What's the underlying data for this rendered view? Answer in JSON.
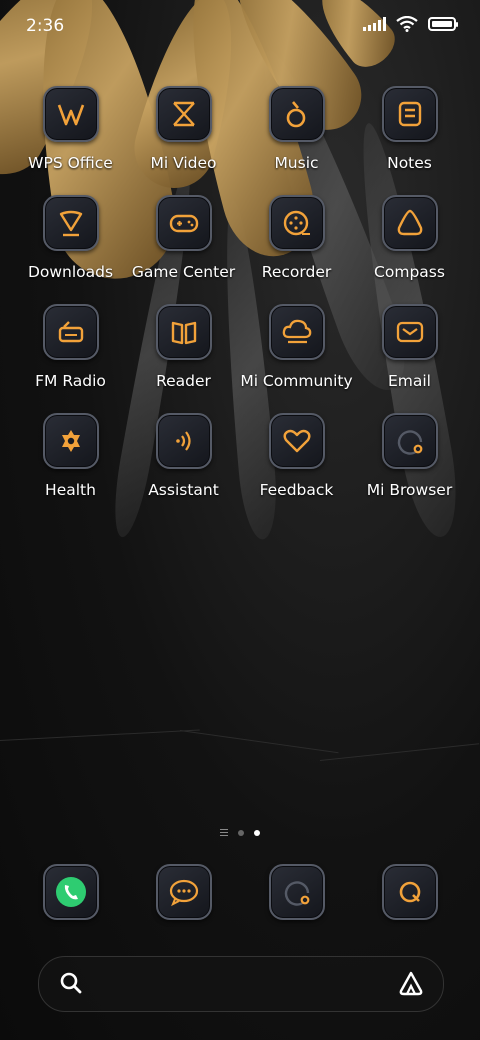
{
  "status": {
    "time": "2:36"
  },
  "apps": [
    {
      "label": "WPS Office",
      "icon": "wps-office-icon"
    },
    {
      "label": "Mi Video",
      "icon": "mi-video-icon"
    },
    {
      "label": "Music",
      "icon": "music-icon"
    },
    {
      "label": "Notes",
      "icon": "notes-icon"
    },
    {
      "label": "Downloads",
      "icon": "downloads-icon"
    },
    {
      "label": "Game Center",
      "icon": "game-center-icon"
    },
    {
      "label": "Recorder",
      "icon": "recorder-icon"
    },
    {
      "label": "Compass",
      "icon": "compass-icon"
    },
    {
      "label": "FM Radio",
      "icon": "fm-radio-icon"
    },
    {
      "label": "Reader",
      "icon": "reader-icon"
    },
    {
      "label": "Mi Community",
      "icon": "mi-community-icon"
    },
    {
      "label": "Email",
      "icon": "email-icon"
    },
    {
      "label": "Health",
      "icon": "health-icon"
    },
    {
      "label": "Assistant",
      "icon": "assistant-icon"
    },
    {
      "label": "Feedback",
      "icon": "feedback-icon"
    },
    {
      "label": "Mi Browser",
      "icon": "mi-browser-icon"
    }
  ],
  "pager": {
    "pages": 2,
    "active": 2
  },
  "dock": [
    {
      "icon": "phone-icon"
    },
    {
      "icon": "messages-icon"
    },
    {
      "icon": "browser-icon"
    },
    {
      "icon": "quick-search-icon"
    }
  ],
  "colors": {
    "accent": "#f2a23a",
    "phone_green": "#2ecc71",
    "tile_border": "#555a66"
  }
}
